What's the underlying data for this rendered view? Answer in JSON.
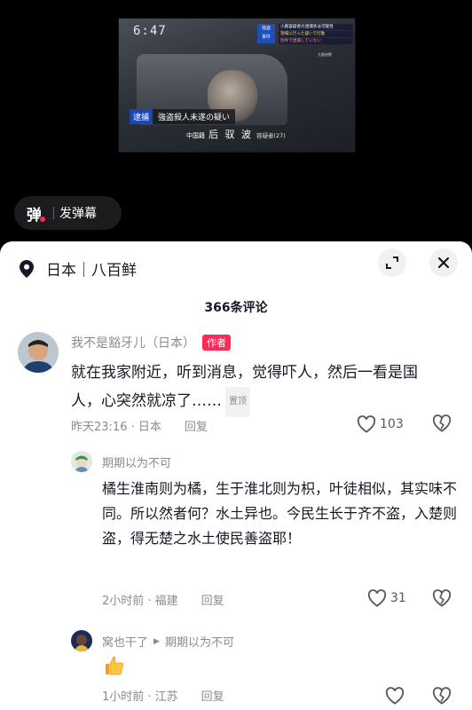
{
  "video": {
    "tv_clock": "6:47",
    "tv_badge": "強盗\n事件",
    "tv_news_lines": [
      "小路容疑者の逮捕状は可能性",
      "現場に行った疑いで行動",
      "別件で逮捕していない"
    ],
    "tv_source": "大阪府警",
    "caption_tag": "逮捕",
    "caption_headline": "強盗殺人未遂の疑い",
    "caption_nationality": "中国籍",
    "caption_name": "后 驭 波",
    "caption_role": "容疑者(27)",
    "danmaku_icon": "弹",
    "danmaku_label": "发弹幕"
  },
  "header": {
    "location": "日本｜八百鲜",
    "comment_count": "366条评论"
  },
  "comments": [
    {
      "user": "我不是豁牙儿（日本）",
      "author_badge": "作者",
      "text": "就在我家附近，听到消息，觉得吓人，然后一看是国人，心突然就凉了……",
      "pin": "置顶",
      "time": "昨天23:16 · 日本",
      "reply": "回复",
      "likes": "103"
    }
  ],
  "replies": [
    {
      "user": "期期以为不可",
      "text": "橘生淮南则为橘，生于淮北则为枳，叶徒相似，其实味不同。所以然者何？水土异也。今民生长于齐不盗，入楚则盗，得无楚之水土使民善盗耶！",
      "time": "2小时前 · 福建",
      "reply": "回复",
      "likes": "31"
    },
    {
      "user": "窝也干了",
      "reply_to": "期期以为不可",
      "time": "1小时前 · 江苏",
      "reply": "回复"
    }
  ],
  "colors": {
    "accent": "#fe2c55",
    "muted": "#8a8b91",
    "text": "#161823"
  }
}
